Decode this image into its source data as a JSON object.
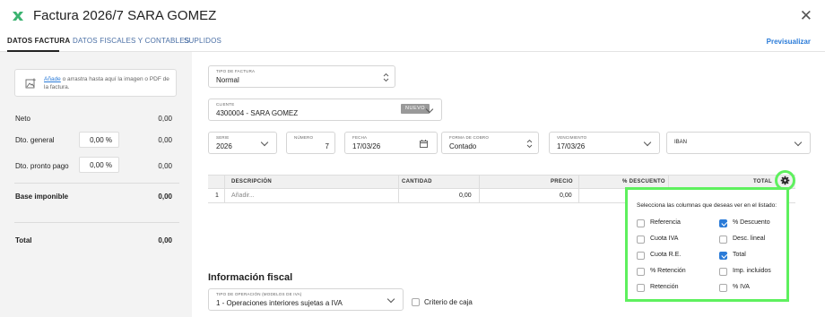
{
  "window": {
    "title": "Factura 2026/7 SARA GOMEZ",
    "close_glyph": "✕"
  },
  "tabs": [
    {
      "label": "DATOS FACTURA",
      "active": true
    },
    {
      "label": "DATOS FISCALES Y CONTABLES",
      "active": false
    },
    {
      "label": "SUPLIDOS",
      "active": false
    }
  ],
  "preview_label": "Previsualizar",
  "sidebar": {
    "dropzone": {
      "link": "Añade",
      "text": " o arrastra hasta aquí la imagen o PDF de la factura."
    },
    "neto": {
      "label": "Neto",
      "value": "0,00"
    },
    "dto_general": {
      "label": "Dto. general",
      "input": "0,00 %",
      "value": "0,00"
    },
    "dto_pronto": {
      "label": "Dto. pronto pago",
      "input": "0,00 %",
      "value": "0,00"
    },
    "base": {
      "label": "Base imponible",
      "value": "0,00"
    },
    "total": {
      "label": "Total",
      "value": "0,00"
    }
  },
  "form": {
    "tipo": {
      "label": "TIPO DE FACTURA",
      "value": "Normal"
    },
    "cliente": {
      "label": "CLIENTE",
      "value": "4300004 - SARA GOMEZ",
      "badge": "NUEVO"
    },
    "serie": {
      "label": "SERIE",
      "value": "2026"
    },
    "numero": {
      "label": "NÚMERO",
      "value": "7"
    },
    "fecha": {
      "label": "FECHA",
      "value": "17/03/26"
    },
    "forma": {
      "label": "FORMA DE COBRO",
      "value": "Contado"
    },
    "vencimiento": {
      "label": "VENCIMIENTO",
      "value": "17/03/26"
    },
    "iban": {
      "label": "IBAN"
    }
  },
  "table": {
    "headers": [
      "DESCRIPCIÓN",
      "CANTIDAD",
      "PRECIO",
      "% DESCUENTO",
      "TOTAL"
    ],
    "row": {
      "index": "1",
      "placeholder": "Añadir...",
      "cantidad": "0,00",
      "precio": "0,00"
    }
  },
  "fiscal": {
    "title": "Información fiscal",
    "tipo_operacion": {
      "label": "TIPO DE OPERACIÓN (MODELOS DE IVA)",
      "value": "1 - Operaciones interiores sujetas a IVA"
    },
    "criterio_caja": {
      "label": "Criterio de caja",
      "checked": false
    }
  },
  "columns_popup": {
    "heading": "Selecciona las columnas que deseas ver en el listado:",
    "options": [
      {
        "label": "Referencia",
        "checked": false
      },
      {
        "label": "% Descuento",
        "checked": true
      },
      {
        "label": "Cuota IVA",
        "checked": false
      },
      {
        "label": "Desc. lineal",
        "checked": false
      },
      {
        "label": "Cuota R.E.",
        "checked": false
      },
      {
        "label": "Total",
        "checked": true
      },
      {
        "label": "% Retención",
        "checked": false
      },
      {
        "label": "Imp. incluidos",
        "checked": false
      },
      {
        "label": "Retención",
        "checked": false
      },
      {
        "label": "% IVA",
        "checked": false
      }
    ]
  },
  "colors": {
    "accent": "#2a7bd8",
    "highlight": "#5ef05e",
    "logo": "#3cb371"
  }
}
